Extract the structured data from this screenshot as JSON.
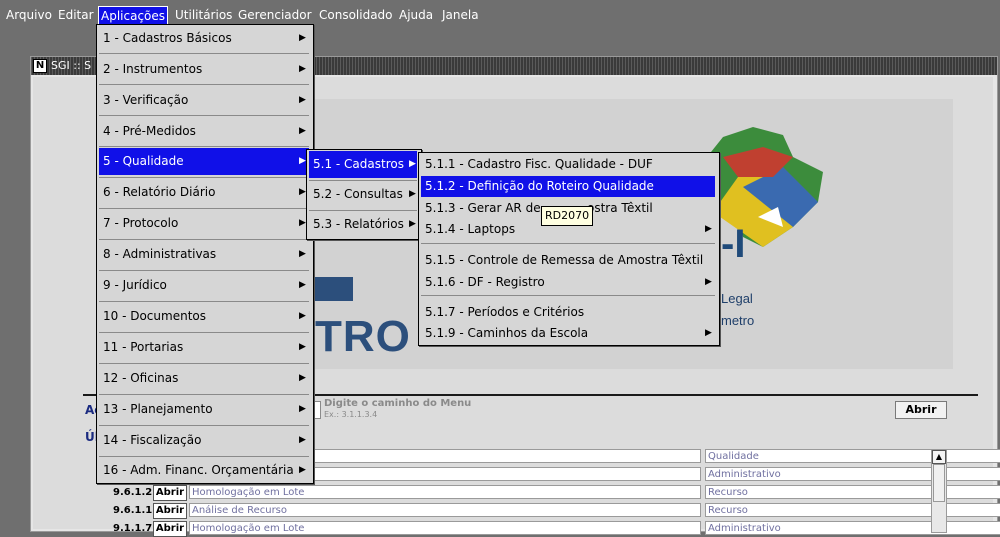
{
  "menubar": [
    {
      "label": "Arquivo",
      "active": false
    },
    {
      "label": "Editar",
      "active": false
    },
    {
      "label": "Aplicações",
      "active": true
    },
    {
      "label": "Utilitários",
      "active": false
    },
    {
      "label": "Gerenciador",
      "active": false
    },
    {
      "label": "Consolidado",
      "active": false
    },
    {
      "label": "Ajuda",
      "active": false
    },
    {
      "label": "Janela",
      "active": false
    }
  ],
  "window": {
    "title": "SGI :: S",
    "icon_letter": "N"
  },
  "menu_aplicacoes": [
    "1 - Cadastros Básicos",
    "2 - Instrumentos",
    "3 - Verificação",
    "4 - Pré-Medidos",
    "5 - Qualidade",
    "6 - Relatório Diário",
    "7 - Protocolo",
    "8 - Administrativas",
    "9 - Jurídico",
    "10 - Documentos",
    "11 - Portarias",
    "12 - Oficinas",
    "13 - Planejamento",
    "14 - Fiscalização",
    "16 - Adm. Financ. Orçamentária"
  ],
  "menu_qualidade": [
    "5.1 - Cadastros",
    "5.2 - Consultas",
    "5.3 - Relatórios"
  ],
  "menu_cadastros": [
    "5.1.1 - Cadastro Fisc. Qualidade - DUF",
    "5.1.2 - Definição do Roteiro Qualidade",
    "5.1.3 - Gerar AR de Amostra Têxtil",
    "5.1.4 - Laptops",
    "5.1.5 - Controle de Remessa de Amostra Têxtil",
    "5.1.6 - DF - Registro",
    "5.1.7 - Períodos e Critérios",
    "5.1.9 - Caminhos da Escola"
  ],
  "menu_cadastros_visible": {
    "item3_left": "5.1.3 - Gerar AR de",
    "item3_right": "ostra Têxtil"
  },
  "tooltip": "RD2070",
  "logo": {
    "tro": "TRO",
    "i": "-I",
    "legal": "Legal",
    "metro": "metro"
  },
  "form": {
    "label_ac": "Ac",
    "label_ul": "Úl",
    "path_hint": "Digite o caminho do Menu",
    "path_example": "Ex.: 3.1.1.3.4",
    "abrir": "Abrir"
  },
  "rows": [
    {
      "code": "",
      "abrir": "",
      "desc": "- DUF",
      "cat": "Qualidade"
    },
    {
      "code": "",
      "abrir": "",
      "desc": "",
      "cat": "Administrativo"
    },
    {
      "code": "9.6.1.2",
      "abrir": "Abrir",
      "desc": "Homologação em Lote",
      "cat": "Recurso"
    },
    {
      "code": "9.6.1.1",
      "abrir": "Abrir",
      "desc": "Análise de Recurso",
      "cat": "Recurso"
    },
    {
      "code": "9.1.1.7",
      "abrir": "Abrir",
      "desc": "Homologação em Lote",
      "cat": "Administrativo"
    }
  ]
}
